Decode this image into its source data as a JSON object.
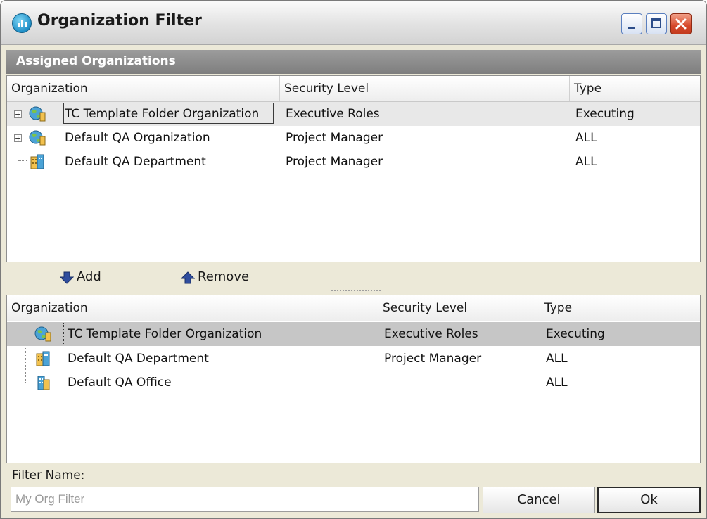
{
  "window": {
    "title": "Organization Filter",
    "app_icon": "org-filter-app-icon",
    "controls": [
      "minimize",
      "maximize",
      "close"
    ]
  },
  "assigned": {
    "header": "Assigned Organizations",
    "columns": {
      "organization": "Organization",
      "security_level": "Security Level",
      "type": "Type"
    },
    "rows": [
      {
        "organization": "TC Template Folder Organization",
        "security_level": "Executive Roles",
        "type": "Executing",
        "icon": "globe-organization-icon",
        "expandable": true,
        "selected": true
      },
      {
        "organization": "Default QA Organization",
        "security_level": "Project Manager",
        "type": "ALL",
        "icon": "globe-organization-icon",
        "expandable": true,
        "selected": false
      },
      {
        "organization": "Default QA Department",
        "security_level": "Project Manager",
        "type": "ALL",
        "icon": "building-department-icon",
        "expandable": false,
        "selected": false
      }
    ]
  },
  "toolbar": {
    "add_label": "Add",
    "remove_label": "Remove",
    "add_icon": "arrow-down-icon",
    "remove_icon": "arrow-up-icon"
  },
  "available": {
    "columns": {
      "organization": "Organization",
      "security_level": "Security Level",
      "type": "Type"
    },
    "rows": [
      {
        "organization": "TC Template Folder Organization",
        "security_level": "Executive Roles",
        "type": "Executing",
        "icon": "globe-organization-icon",
        "selected": true
      },
      {
        "organization": "Default QA Department",
        "security_level": "Project Manager",
        "type": "ALL",
        "icon": "building-department-icon",
        "selected": false
      },
      {
        "organization": "Default QA Office",
        "security_level": "",
        "type": "ALL",
        "icon": "building-office-icon",
        "selected": false
      }
    ]
  },
  "filter": {
    "label": "Filter Name:",
    "value": "My Org Filter"
  },
  "buttons": {
    "cancel": "Cancel",
    "ok": "Ok"
  },
  "colors": {
    "header_band": "#8A8A8A",
    "window_bg": "#ECE9D8",
    "selected_row": "#C6C6C6",
    "arrow_blue": "#2F4D9E"
  }
}
